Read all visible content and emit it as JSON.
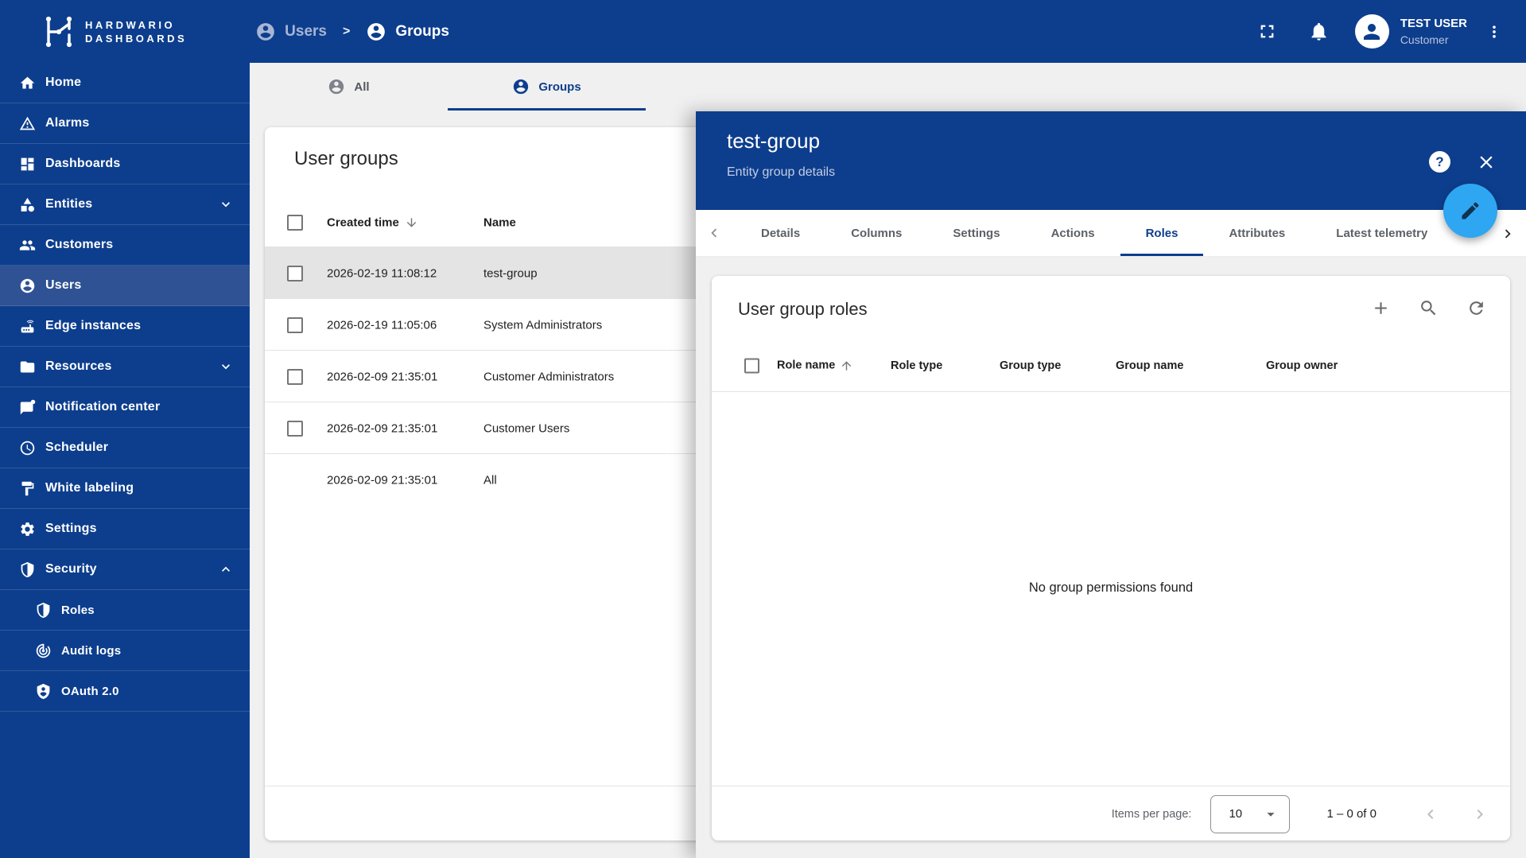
{
  "colors": {
    "navy": "#0d3e8d",
    "sidebar_selected": "#2e5294",
    "fab_blue": "#2ea6f2",
    "bg_gray": "#f0f0f0",
    "row_selected": "#e4e4e4",
    "divider": "#e3e3e3"
  },
  "topbar": {
    "logo_line1": "HARDWARIO",
    "logo_line2": "DASHBOARDS",
    "breadcrumb_users": "Users",
    "breadcrumb_sep": ">",
    "breadcrumb_groups": "Groups",
    "user_name": "TEST USER",
    "user_role": "Customer"
  },
  "sidebar": {
    "items": [
      {
        "label": "Home",
        "icon": "home"
      },
      {
        "label": "Alarms",
        "icon": "warning"
      },
      {
        "label": "Dashboards",
        "icon": "dashboard"
      },
      {
        "label": "Entities",
        "icon": "category",
        "chevron": "down"
      },
      {
        "label": "Customers",
        "icon": "people"
      },
      {
        "label": "Users",
        "icon": "account-circle",
        "selected": true
      },
      {
        "label": "Edge instances",
        "icon": "router"
      },
      {
        "label": "Resources",
        "icon": "folder",
        "chevron": "down"
      },
      {
        "label": "Notification center",
        "icon": "chat-dot"
      },
      {
        "label": "Scheduler",
        "icon": "clock"
      },
      {
        "label": "White labeling",
        "icon": "paint"
      },
      {
        "label": "Settings",
        "icon": "gear"
      },
      {
        "label": "Security",
        "icon": "shield",
        "chevron": "up"
      },
      {
        "label": "Roles",
        "icon": "shield",
        "sub": true
      },
      {
        "label": "Audit logs",
        "icon": "track-changes",
        "sub": true
      },
      {
        "label": "OAuth 2.0",
        "icon": "shield-person",
        "sub": true
      }
    ]
  },
  "main_tabs": {
    "all": "All",
    "groups": "Groups"
  },
  "groups_card": {
    "title": "User groups",
    "col_created": "Created time",
    "col_name": "Name",
    "sort_direction": "desc",
    "rows": [
      {
        "created": "2026-02-19 11:08:12",
        "name": "test-group",
        "selected": true,
        "has_checkbox": true
      },
      {
        "created": "2026-02-19 11:05:06",
        "name": "System Administrators",
        "has_checkbox": true
      },
      {
        "created": "2026-02-09 21:35:01",
        "name": "Customer Administrators",
        "has_checkbox": true
      },
      {
        "created": "2026-02-09 21:35:01",
        "name": "Customer Users",
        "has_checkbox": true
      },
      {
        "created": "2026-02-09 21:35:01",
        "name": "All",
        "has_checkbox": false
      }
    ]
  },
  "panel": {
    "title": "test-group",
    "subtitle": "Entity group details",
    "help_glyph": "?",
    "tabs": [
      "Details",
      "Columns",
      "Settings",
      "Actions",
      "Roles",
      "Attributes",
      "Latest telemetry"
    ],
    "active_tab": "Roles",
    "roles_card": {
      "title": "User group roles",
      "columns": [
        "Role name",
        "Role type",
        "Group type",
        "Group name",
        "Group owner"
      ],
      "sort_column": "Role name",
      "sort_direction": "asc",
      "empty_text": "No group permissions found",
      "items_per_page_label": "Items per page:",
      "items_per_page_value": "10",
      "range_text": "1 – 0 of 0"
    }
  }
}
